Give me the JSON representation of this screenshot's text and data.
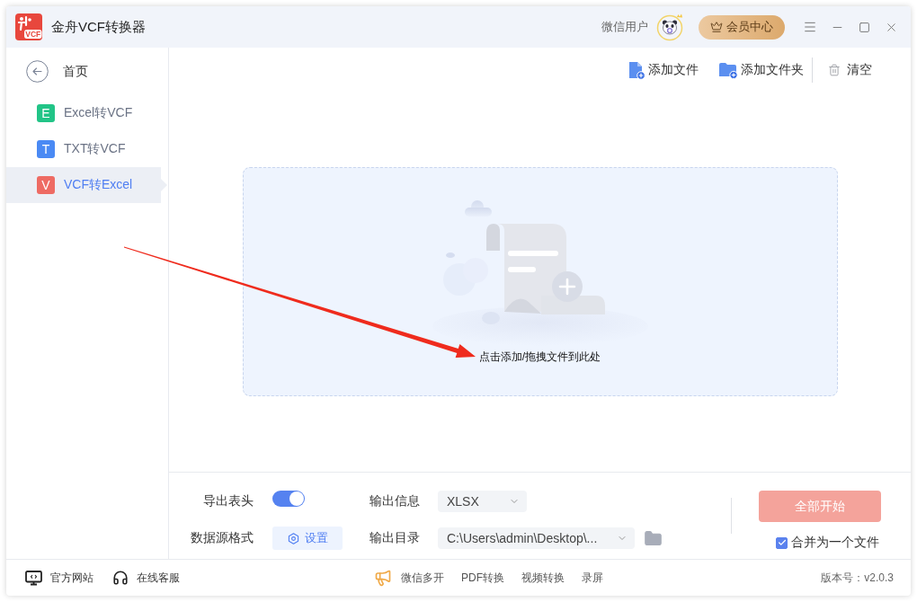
{
  "window": {
    "logo_text": "VCF",
    "title": "金舟VCF转换器",
    "user_name": "微信用户",
    "vip_button": "会员中心"
  },
  "sidebar": {
    "home": "首页",
    "items": [
      {
        "badge": "E",
        "label": "Excel转VCF",
        "color": "#22c487",
        "selected": false
      },
      {
        "badge": "T",
        "label": "TXT转VCF",
        "color": "#4a8af4",
        "selected": false
      },
      {
        "badge": "V",
        "label": "VCF转Excel",
        "color": "#ee6b63",
        "selected": true
      }
    ]
  },
  "toolbar": [
    {
      "kind": "file",
      "label": "添加文件"
    },
    {
      "kind": "folder",
      "label": "添加文件夹"
    },
    {
      "kind": "clear",
      "label": "清空"
    }
  ],
  "drop_zone": {
    "hint": "点击添加/拖拽文件到此处"
  },
  "options": {
    "export_header": {
      "label": "导出表头",
      "on": true
    },
    "source_format": {
      "label": "数据源格式",
      "button": "设置"
    },
    "output_info": {
      "label": "输出信息",
      "value": "XLSX"
    },
    "output_dir": {
      "label": "输出目录",
      "value": "C:\\Users\\admin\\Desktop\\..."
    }
  },
  "actions": {
    "start_button": {
      "label": "全部开始",
      "disabled": true
    },
    "merge": {
      "label": "合并为一个文件",
      "checked": true
    }
  },
  "footer": {
    "links": [
      {
        "kind": "website",
        "label": "官方网站"
      },
      {
        "kind": "support",
        "label": "在线客服"
      }
    ],
    "tools": [
      {
        "kind": "promo",
        "label": "微信多开"
      },
      {
        "kind": "plain",
        "label": "PDF转换"
      },
      {
        "kind": "plain",
        "label": "视频转换"
      },
      {
        "kind": "plain",
        "label": "录屏"
      }
    ],
    "version": "版本号：v2.0.3"
  }
}
